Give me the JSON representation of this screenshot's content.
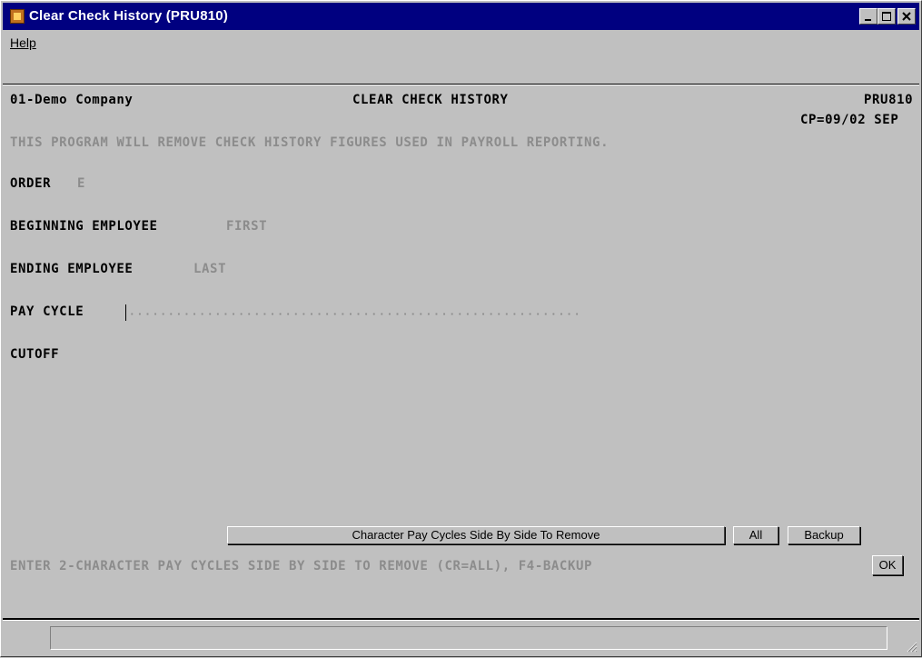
{
  "window": {
    "title": "Clear Check History (PRU810)"
  },
  "menu": {
    "help_label": "Help"
  },
  "header": {
    "company": "01-Demo Company",
    "program_title": "CLEAR CHECK HISTORY",
    "program_code": "PRU810",
    "period": "CP=09/02 SEP"
  },
  "description": "THIS PROGRAM WILL REMOVE CHECK HISTORY FIGURES USED IN PAYROLL REPORTING.",
  "fields": {
    "order_label": "ORDER",
    "order_value": "E",
    "beginning_employee_label": "BEGINNING EMPLOYEE",
    "beginning_employee_value": "FIRST",
    "ending_employee_label": "ENDING EMPLOYEE",
    "ending_employee_value": "LAST",
    "pay_cycle_label": "PAY CYCLE",
    "pay_cycle_value": "",
    "cutoff_label": "CUTOFF"
  },
  "prompt_buttons": {
    "prompt_label": "Character Pay Cycles Side By Side To Remove",
    "all_label": "All",
    "backup_label": "Backup",
    "ok_label": "OK"
  },
  "instruction": "ENTER 2-CHARACTER PAY CYCLES SIDE BY SIDE TO REMOVE (CR=ALL), F4-BACKUP",
  "statusbar": {
    "text": ""
  },
  "colors": {
    "titlebar": "#000080",
    "window_bg": "#c0c0c0",
    "dim_text": "#8c8c8c"
  }
}
